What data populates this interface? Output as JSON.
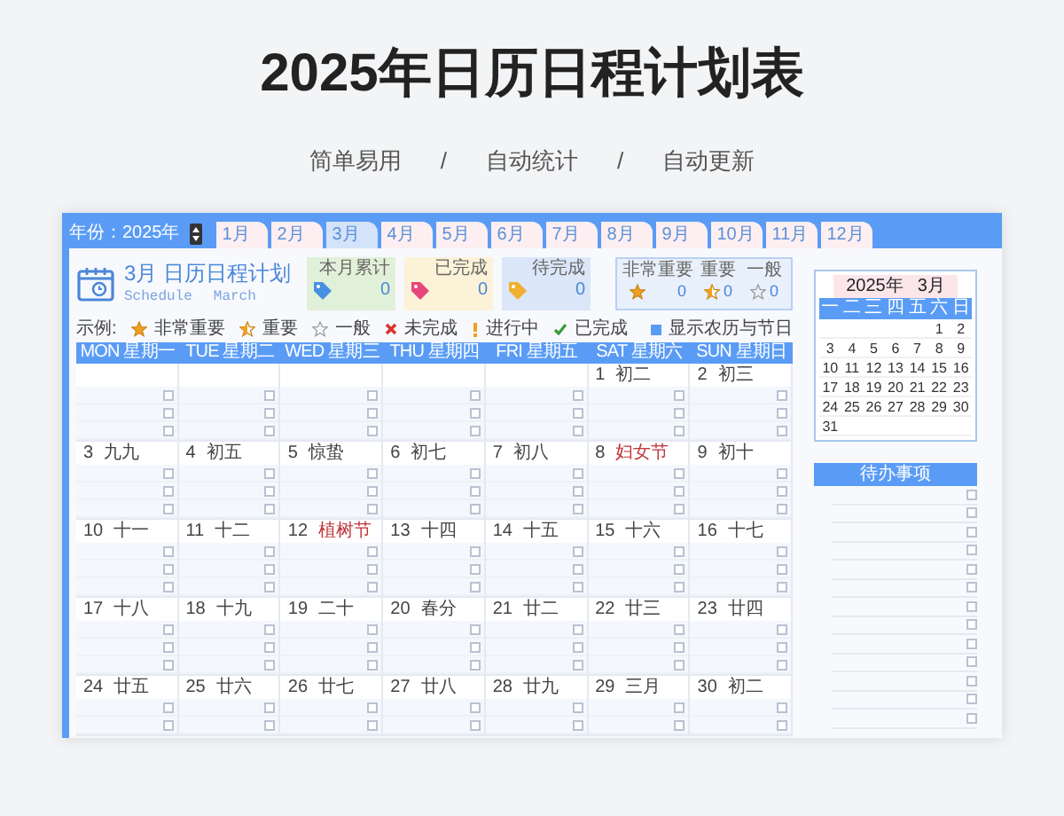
{
  "heading": "2025年日历日程计划表",
  "subtitle": [
    "简单易用",
    "/",
    "自动统计",
    "/",
    "自动更新"
  ],
  "year_picker": {
    "label": "年份：2025年"
  },
  "month_tabs": [
    {
      "label": "1月",
      "selected": false
    },
    {
      "label": "2月",
      "selected": false
    },
    {
      "label": "3月",
      "selected": true
    },
    {
      "label": "4月",
      "selected": false
    },
    {
      "label": "5月",
      "selected": false
    },
    {
      "label": "6月",
      "selected": false
    },
    {
      "label": "7月",
      "selected": false
    },
    {
      "label": "8月",
      "selected": false
    },
    {
      "label": "9月",
      "selected": false
    },
    {
      "label": "10月",
      "selected": false
    },
    {
      "label": "11月",
      "selected": false
    },
    {
      "label": "12月",
      "selected": false
    }
  ],
  "title": "3月 日历日程计划",
  "title_en": [
    "Schedule",
    "March"
  ],
  "stats": [
    {
      "kind": "total",
      "label": "本月累计",
      "value": "0"
    },
    {
      "kind": "done",
      "label": "已完成",
      "value": "0"
    },
    {
      "kind": "pending",
      "label": "待完成",
      "value": "0"
    }
  ],
  "priority": [
    {
      "kind": "high",
      "label": "非常重要",
      "count": "0"
    },
    {
      "kind": "mid",
      "label": "重要",
      "count": "0"
    },
    {
      "kind": "low",
      "label": "一般",
      "count": "0"
    }
  ],
  "legend": {
    "label": "示例:",
    "items": [
      {
        "kind": "high",
        "label": "非常重要"
      },
      {
        "kind": "mid",
        "label": "重要"
      },
      {
        "kind": "low",
        "label": "一般"
      },
      {
        "kind": "todo",
        "label": "未完成"
      },
      {
        "kind": "doing",
        "label": "进行中"
      },
      {
        "kind": "done",
        "label": "已完成"
      }
    ]
  },
  "lunar_toggle": {
    "label": "显示农历与节日",
    "checked": true
  },
  "weekdays": [
    "MON 星期一",
    "TUE 星期二",
    "WED 星期三",
    "THU 星期四",
    "FRI 星期五",
    "SAT 星期六",
    "SUN 星期日"
  ],
  "weeks": [
    [
      {
        "tasks": [
          {
            "checked": false
          },
          {
            "checked": false
          },
          {
            "checked": false
          }
        ]
      },
      {
        "tasks": [
          {
            "checked": false
          },
          {
            "checked": false
          },
          {
            "checked": false
          }
        ]
      },
      {
        "tasks": [
          {
            "checked": false
          },
          {
            "checked": false
          },
          {
            "checked": false
          }
        ]
      },
      {
        "tasks": [
          {
            "checked": false
          },
          {
            "checked": false
          },
          {
            "checked": false
          }
        ]
      },
      {
        "tasks": [
          {
            "checked": false
          },
          {
            "checked": false
          },
          {
            "checked": false
          }
        ]
      },
      {
        "day": "1",
        "lunar": "初二",
        "festival": false,
        "tasks": [
          {
            "checked": false
          },
          {
            "checked": false
          },
          {
            "checked": false
          }
        ]
      },
      {
        "day": "2",
        "lunar": "初三",
        "festival": false,
        "tasks": [
          {
            "checked": false
          },
          {
            "checked": false
          },
          {
            "checked": false
          }
        ]
      }
    ],
    [
      {
        "day": "3",
        "lunar": "九九",
        "festival": false,
        "tasks": [
          {
            "checked": false
          },
          {
            "checked": false
          },
          {
            "checked": false
          }
        ]
      },
      {
        "day": "4",
        "lunar": "初五",
        "festival": false,
        "tasks": [
          {
            "checked": false
          },
          {
            "checked": false
          },
          {
            "checked": false
          }
        ]
      },
      {
        "day": "5",
        "lunar": "惊蛰",
        "festival": false,
        "tasks": [
          {
            "checked": false
          },
          {
            "checked": false
          },
          {
            "checked": false
          }
        ]
      },
      {
        "day": "6",
        "lunar": "初七",
        "festival": false,
        "tasks": [
          {
            "checked": false
          },
          {
            "checked": false
          },
          {
            "checked": false
          }
        ]
      },
      {
        "day": "7",
        "lunar": "初八",
        "festival": false,
        "tasks": [
          {
            "checked": false
          },
          {
            "checked": false
          },
          {
            "checked": false
          }
        ]
      },
      {
        "day": "8",
        "lunar": "妇女节",
        "festival": true,
        "tasks": [
          {
            "checked": false
          },
          {
            "checked": false
          },
          {
            "checked": false
          }
        ]
      },
      {
        "day": "9",
        "lunar": "初十",
        "festival": false,
        "tasks": [
          {
            "checked": false
          },
          {
            "checked": false
          },
          {
            "checked": false
          }
        ]
      }
    ],
    [
      {
        "day": "10",
        "lunar": "十一",
        "festival": false,
        "tasks": [
          {
            "checked": false
          },
          {
            "checked": false
          },
          {
            "checked": false
          }
        ]
      },
      {
        "day": "11",
        "lunar": "十二",
        "festival": false,
        "tasks": [
          {
            "checked": false
          },
          {
            "checked": false
          },
          {
            "checked": false
          }
        ]
      },
      {
        "day": "12",
        "lunar": "植树节",
        "festival": true,
        "tasks": [
          {
            "checked": false
          },
          {
            "checked": false
          },
          {
            "checked": false
          }
        ]
      },
      {
        "day": "13",
        "lunar": "十四",
        "festival": false,
        "tasks": [
          {
            "checked": false
          },
          {
            "checked": false
          },
          {
            "checked": false
          }
        ]
      },
      {
        "day": "14",
        "lunar": "十五",
        "festival": false,
        "tasks": [
          {
            "checked": false
          },
          {
            "checked": false
          },
          {
            "checked": false
          }
        ]
      },
      {
        "day": "15",
        "lunar": "十六",
        "festival": false,
        "tasks": [
          {
            "checked": false
          },
          {
            "checked": false
          },
          {
            "checked": false
          }
        ]
      },
      {
        "day": "16",
        "lunar": "十七",
        "festival": false,
        "tasks": [
          {
            "checked": false
          },
          {
            "checked": false
          },
          {
            "checked": false
          }
        ]
      }
    ],
    [
      {
        "day": "17",
        "lunar": "十八",
        "festival": false,
        "tasks": [
          {
            "checked": false
          },
          {
            "checked": false
          },
          {
            "checked": false
          }
        ]
      },
      {
        "day": "18",
        "lunar": "十九",
        "festival": false,
        "tasks": [
          {
            "checked": false
          },
          {
            "checked": false
          },
          {
            "checked": false
          }
        ]
      },
      {
        "day": "19",
        "lunar": "二十",
        "festival": false,
        "tasks": [
          {
            "checked": false
          },
          {
            "checked": false
          },
          {
            "checked": false
          }
        ]
      },
      {
        "day": "20",
        "lunar": "春分",
        "festival": false,
        "tasks": [
          {
            "checked": false
          },
          {
            "checked": false
          },
          {
            "checked": false
          }
        ]
      },
      {
        "day": "21",
        "lunar": "廿二",
        "festival": false,
        "tasks": [
          {
            "checked": false
          },
          {
            "checked": false
          },
          {
            "checked": false
          }
        ]
      },
      {
        "day": "22",
        "lunar": "廿三",
        "festival": false,
        "tasks": [
          {
            "checked": false
          },
          {
            "checked": false
          },
          {
            "checked": false
          }
        ]
      },
      {
        "day": "23",
        "lunar": "廿四",
        "festival": false,
        "tasks": [
          {
            "checked": false
          },
          {
            "checked": false
          },
          {
            "checked": false
          }
        ]
      }
    ],
    [
      {
        "day": "24",
        "lunar": "廿五",
        "festival": false,
        "tasks": [
          {
            "checked": false
          },
          {
            "checked": false
          }
        ]
      },
      {
        "day": "25",
        "lunar": "廿六",
        "festival": false,
        "tasks": [
          {
            "checked": false
          },
          {
            "checked": false
          }
        ]
      },
      {
        "day": "26",
        "lunar": "廿七",
        "festival": false,
        "tasks": [
          {
            "checked": false
          },
          {
            "checked": false
          }
        ]
      },
      {
        "day": "27",
        "lunar": "廿八",
        "festival": false,
        "tasks": [
          {
            "checked": false
          },
          {
            "checked": false
          }
        ]
      },
      {
        "day": "28",
        "lunar": "廿九",
        "festival": false,
        "tasks": [
          {
            "checked": false
          },
          {
            "checked": false
          }
        ]
      },
      {
        "day": "29",
        "lunar": "三月",
        "festival": false,
        "tasks": [
          {
            "checked": false
          },
          {
            "checked": false
          }
        ]
      },
      {
        "day": "30",
        "lunar": "初二",
        "festival": false,
        "tasks": [
          {
            "checked": false
          },
          {
            "checked": false
          }
        ]
      }
    ]
  ],
  "mini_calendar": {
    "year": "2025年",
    "month": "3月",
    "weekdays": [
      "一",
      "二",
      "三",
      "四",
      "五",
      "六",
      "日"
    ],
    "weeks": [
      {
        "kind": "first",
        "days": [
          "1",
          "2"
        ]
      },
      {
        "kind": "full",
        "days": [
          "3",
          "4",
          "5",
          "6",
          "7",
          "8",
          "9"
        ]
      },
      {
        "kind": "full",
        "days": [
          "10",
          "11",
          "12",
          "13",
          "14",
          "15",
          "16"
        ]
      },
      {
        "kind": "full",
        "days": [
          "17",
          "18",
          "19",
          "20",
          "21",
          "22",
          "23"
        ]
      },
      {
        "kind": "full",
        "days": [
          "24",
          "25",
          "26",
          "27",
          "28",
          "29",
          "30"
        ]
      },
      {
        "kind": "last",
        "days": [
          "31"
        ]
      }
    ]
  },
  "todo": {
    "title": "待办事项",
    "items": [
      {
        "checked": false
      },
      {
        "checked": false
      },
      {
        "checked": false
      },
      {
        "checked": false
      },
      {
        "checked": false
      },
      {
        "checked": false
      },
      {
        "checked": false
      },
      {
        "checked": false
      },
      {
        "checked": false
      },
      {
        "checked": false
      },
      {
        "checked": false
      },
      {
        "checked": false
      },
      {
        "checked": false
      }
    ]
  }
}
